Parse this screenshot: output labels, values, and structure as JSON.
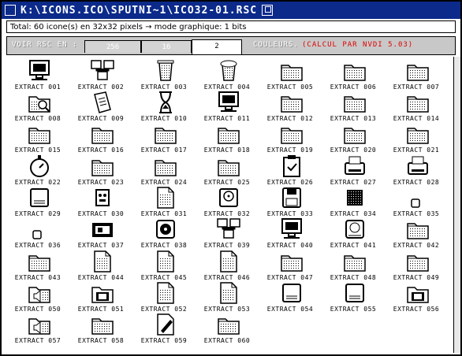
{
  "window": {
    "title": "K:\\ICONS.ICO\\SPUTNI~1\\ICO32-01.RSC"
  },
  "info": {
    "text": "Total: 60 icone(s) en 32x32 pixels → mode graphique: 1 bits"
  },
  "toolbar": {
    "voir_label": "VOIR RSC EN :",
    "tabs": [
      {
        "label": "256",
        "active": false
      },
      {
        "label": "16",
        "active": false
      },
      {
        "label": "2",
        "active": true
      }
    ],
    "couleurs_label": "COULEURS.",
    "calc_label": "(CALCUL PAR NVDI 5.03)",
    "calc_color": "#e00000"
  },
  "icons": [
    {
      "label": "EXTRACT 001",
      "icon": "monitor-icon"
    },
    {
      "label": "EXTRACT 002",
      "icon": "network-computers-icon"
    },
    {
      "label": "EXTRACT 003",
      "icon": "trash-can-icon"
    },
    {
      "label": "EXTRACT 004",
      "icon": "trash-full-icon"
    },
    {
      "label": "EXTRACT 005",
      "icon": "folder-icon"
    },
    {
      "label": "EXTRACT 006",
      "icon": "folder-icon"
    },
    {
      "label": "EXTRACT 007",
      "icon": "folder-icon"
    },
    {
      "label": "EXTRACT 008",
      "icon": "folder-search-icon"
    },
    {
      "label": "EXTRACT 009",
      "icon": "book-icon"
    },
    {
      "label": "EXTRACT 010",
      "icon": "hourglass-icon"
    },
    {
      "label": "EXTRACT 011",
      "icon": "monitor-icon"
    },
    {
      "label": "EXTRACT 012",
      "icon": "folder-icon"
    },
    {
      "label": "EXTRACT 013",
      "icon": "folder-icon"
    },
    {
      "label": "EXTRACT 014",
      "icon": "folder-icon"
    },
    {
      "label": "EXTRACT 015",
      "icon": "folder-icon"
    },
    {
      "label": "EXTRACT 016",
      "icon": "folder-icon"
    },
    {
      "label": "EXTRACT 017",
      "icon": "folder-icon"
    },
    {
      "label": "EXTRACT 018",
      "icon": "folder-icon"
    },
    {
      "label": "EXTRACT 019",
      "icon": "folder-icon"
    },
    {
      "label": "EXTRACT 020",
      "icon": "folder-icon"
    },
    {
      "label": "EXTRACT 021",
      "icon": "folder-icon"
    },
    {
      "label": "EXTRACT 022",
      "icon": "stopwatch-icon"
    },
    {
      "label": "EXTRACT 023",
      "icon": "folder-icon"
    },
    {
      "label": "EXTRACT 024",
      "icon": "folder-icon"
    },
    {
      "label": "EXTRACT 025",
      "icon": "folder-icon"
    },
    {
      "label": "EXTRACT 026",
      "icon": "clipboard-icon"
    },
    {
      "label": "EXTRACT 027",
      "icon": "printer-icon"
    },
    {
      "label": "EXTRACT 028",
      "icon": "printer-icon"
    },
    {
      "label": "EXTRACT 029",
      "icon": "drive-icon"
    },
    {
      "label": "EXTRACT 030",
      "icon": "robot-icon"
    },
    {
      "label": "EXTRACT 031",
      "icon": "document-icon"
    },
    {
      "label": "EXTRACT 032",
      "icon": "cd-drive-icon"
    },
    {
      "label": "EXTRACT 033",
      "icon": "floppy-icon"
    },
    {
      "label": "EXTRACT 034",
      "icon": "pattern-icon"
    },
    {
      "label": "EXTRACT 035",
      "icon": "small-icon"
    },
    {
      "label": "EXTRACT 036",
      "icon": "small-icon"
    },
    {
      "label": "EXTRACT 037",
      "icon": "film-icon"
    },
    {
      "label": "EXTRACT 038",
      "icon": "music-icon"
    },
    {
      "label": "EXTRACT 039",
      "icon": "network-computers-icon"
    },
    {
      "label": "EXTRACT 040",
      "icon": "monitor-icon"
    },
    {
      "label": "EXTRACT 041",
      "icon": "speaker-icon"
    },
    {
      "label": "EXTRACT 042",
      "icon": "folder-icon"
    },
    {
      "label": "EXTRACT 043",
      "icon": "folder-icon"
    },
    {
      "label": "EXTRACT 044",
      "icon": "document-icon"
    },
    {
      "label": "EXTRACT 045",
      "icon": "document-icon"
    },
    {
      "label": "EXTRACT 046",
      "icon": "document-icon"
    },
    {
      "label": "EXTRACT 047",
      "icon": "folder-icon"
    },
    {
      "label": "EXTRACT 048",
      "icon": "folder-icon"
    },
    {
      "label": "EXTRACT 049",
      "icon": "folder-icon"
    },
    {
      "label": "EXTRACT 050",
      "icon": "folder-sound-icon"
    },
    {
      "label": "EXTRACT 051",
      "icon": "folder-film-icon"
    },
    {
      "label": "EXTRACT 052",
      "icon": "document-icon"
    },
    {
      "label": "EXTRACT 053",
      "icon": "document-icon"
    },
    {
      "label": "EXTRACT 054",
      "icon": "drive-icon"
    },
    {
      "label": "EXTRACT 055",
      "icon": "drive-icon"
    },
    {
      "label": "EXTRACT 056",
      "icon": "folder-film-icon"
    },
    {
      "label": "EXTRACT 057",
      "icon": "folder-sound-icon"
    },
    {
      "label": "EXTRACT 058",
      "icon": "folder-icon"
    },
    {
      "label": "EXTRACT 059",
      "icon": "document-pen-icon"
    },
    {
      "label": "EXTRACT 060",
      "icon": "folder-icon"
    }
  ]
}
